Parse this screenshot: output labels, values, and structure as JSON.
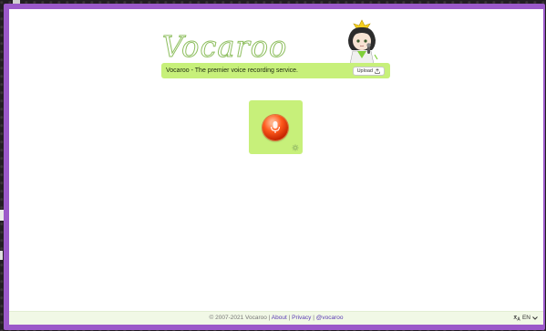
{
  "header": {
    "logo_text": "Vocaroo",
    "tagline": "Vocaroo - The premier voice recording service.",
    "upload_label": "Upload",
    "upload_icon": "upload-icon"
  },
  "recorder": {
    "record_icon": "microphone-icon",
    "settings_icon": "gear-icon"
  },
  "footer": {
    "copyright": "© 2007-2021 Vocaroo | ",
    "links": [
      "About",
      "Privacy",
      "@vocaroo"
    ],
    "separator": " | ",
    "language": "EN",
    "language_icon": "translate-icon"
  },
  "colors": {
    "accent": "#c7f07a",
    "frame": "#9b59c9",
    "link": "#5b3bb5",
    "record": "#ff5a1c"
  }
}
